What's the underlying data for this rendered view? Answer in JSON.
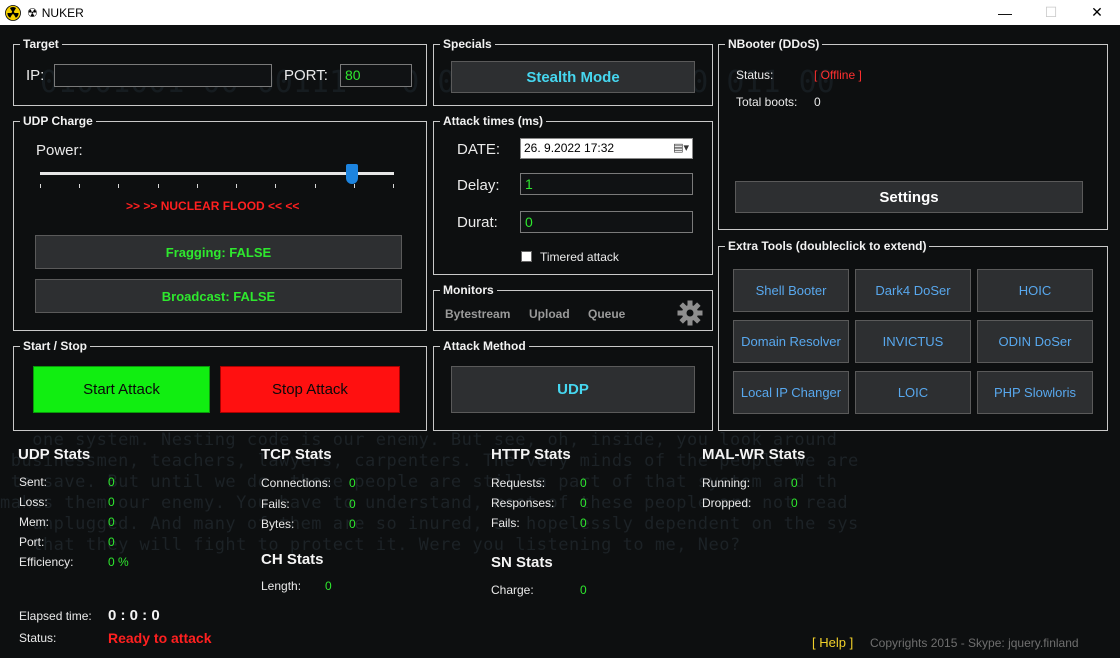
{
  "window": {
    "title": "NUKER",
    "title_glyph": "☢",
    "controls": {
      "minimize": "—",
      "maximize": "☐",
      "close": "✕"
    }
  },
  "background": {
    "binary": "01001001 00 00111   0 010110100 01010 011 00",
    "code": [
      "   one system. Nesting code is our enemy. But see, oh, inside, you look around",
      " businessmen, teachers, lawyers, carpenters. The very minds of the people we are",
      " to save. But until we do, these people are still a part of that system and th",
      "makes them our enemy. You have to understand, most of these people are not read",
      "   unplugged. And many of them are so inured, so hopelessly dependent on the sys",
      "   that they will fight to protect it. Were you listening to me, Neo?"
    ]
  },
  "target": {
    "legend": "Target",
    "ip_label": "IP:",
    "ip_value": "",
    "port_label": "PORT:",
    "port_value": "80"
  },
  "specials": {
    "legend": "Specials",
    "stealth_button": "Stealth Mode"
  },
  "nbooter": {
    "legend": "NBooter (DDoS)",
    "status_label": "Status:",
    "status_value": "[ Offline ]",
    "total_boots_label": "Total boots:",
    "total_boots_value": "0",
    "settings_button": "Settings"
  },
  "udp_charge": {
    "legend": "UDP Charge",
    "power_label": "Power:",
    "power_level": 0.88,
    "flood_text": ">> >> NUCLEAR FLOOD <<  <<",
    "fragging_button": "Fragging: FALSE",
    "broadcast_button": "Broadcast: FALSE"
  },
  "attack_times": {
    "legend": "Attack times (ms)",
    "date_label": "DATE:",
    "date_value": "26.  9.2022 17:32",
    "delay_label": "Delay:",
    "delay_value": "1",
    "durat_label": "Durat:",
    "durat_value": "0",
    "timered_label": "Timered attack"
  },
  "monitors": {
    "legend": "Monitors",
    "items": [
      "Bytestream",
      "Upload",
      "Queue"
    ]
  },
  "extra_tools": {
    "legend": "Extra Tools  (doubleclick to extend)",
    "tools": [
      "Shell Booter",
      "Dark4 DoSer",
      "HOIC",
      "Domain Resolver",
      "INVICTUS",
      "ODIN DoSer",
      "Local IP Changer",
      "LOIC",
      "PHP Slowloris"
    ]
  },
  "start_stop": {
    "legend": "Start / Stop",
    "start_button": "Start Attack",
    "stop_button": "Stop Attack",
    "start_color": "#11ee11",
    "stop_color": "#ff1010"
  },
  "attack_method": {
    "legend": "Attack Method",
    "method_button": "UDP"
  },
  "udp_stats": {
    "title": "UDP Stats",
    "rows": [
      {
        "label": "Sent:",
        "value": "0"
      },
      {
        "label": "Loss:",
        "value": "0"
      },
      {
        "label": "Mem:",
        "value": "0"
      },
      {
        "label": "Port:",
        "value": "0"
      },
      {
        "label": "Efficiency:",
        "value": "0 %"
      }
    ]
  },
  "tcp_stats": {
    "title": "TCP Stats",
    "rows": [
      {
        "label": "Connections:",
        "value": "0"
      },
      {
        "label": "Fails:",
        "value": "0"
      },
      {
        "label": "Bytes:",
        "value": "0"
      }
    ]
  },
  "ch_stats": {
    "title": "CH Stats",
    "rows": [
      {
        "label": "Length:",
        "value": "0"
      }
    ]
  },
  "http_stats": {
    "title": "HTTP Stats",
    "rows": [
      {
        "label": "Requests:",
        "value": "0"
      },
      {
        "label": "Responses:",
        "value": "0"
      },
      {
        "label": "Fails:",
        "value": "0"
      }
    ]
  },
  "sn_stats": {
    "title": "SN Stats",
    "rows": [
      {
        "label": "Charge:",
        "value": "0"
      }
    ]
  },
  "malwr_stats": {
    "title": "MAL-WR Stats",
    "rows": [
      {
        "label": "Running:",
        "value": "0"
      },
      {
        "label": "Dropped:",
        "value": "0"
      }
    ]
  },
  "status_area": {
    "elapsed_label": "Elapsed time:",
    "elapsed_value": "0 : 0 : 0",
    "status_label": "Status:",
    "status_value": "Ready to attack"
  },
  "footer": {
    "help": "[ Help ]",
    "copyright": "Copyrights 2015   -   Skype: jquery.finland"
  },
  "colors": {
    "accent_green": "#2ee82e",
    "accent_cyan": "#46d7f0",
    "accent_blue": "#58a8ee",
    "offline_red": "#ff3030",
    "help_yellow": "#f2d12a"
  }
}
